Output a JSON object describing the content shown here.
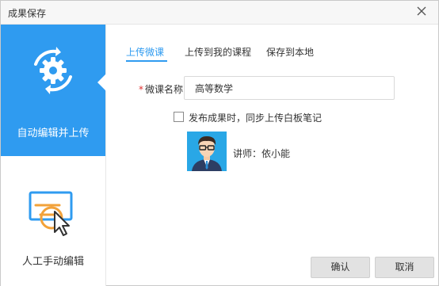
{
  "window": {
    "title": "成果保存"
  },
  "sidebar": {
    "items": [
      {
        "label": "自动编辑并上传",
        "icon": "gear-sync-icon",
        "active": true
      },
      {
        "label": "人工手动编辑",
        "icon": "screen-edit-icon",
        "active": false
      }
    ]
  },
  "tabs": [
    {
      "label": "上传微课",
      "active": true
    },
    {
      "label": "上传到我的课程",
      "active": false
    },
    {
      "label": "保存到本地",
      "active": false
    }
  ],
  "form": {
    "required_mark": "*",
    "name_label": "微课名称",
    "name_value": "高等数学",
    "sync_checkbox_label": "发布成果时，同步上传白板笔记",
    "sync_checked": false,
    "teacher_label": "讲师：依小能"
  },
  "footer": {
    "ok_label": "确认",
    "cancel_label": "取消"
  },
  "colors": {
    "accent": "#2f9bf0",
    "required": "#e0302f",
    "button_bg": "#e2e2e2"
  }
}
